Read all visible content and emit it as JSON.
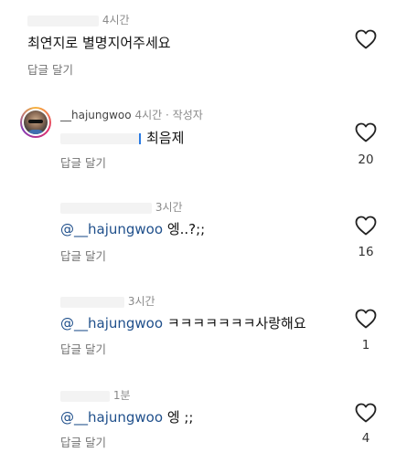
{
  "comments": [
    {
      "time": "4시간",
      "text": "최연지로 별명지어주세요",
      "reply_label": "답글 달기",
      "likes": ""
    },
    {
      "username": "__hajungwoo",
      "time": "4시간",
      "author_badge": "작성자",
      "text": "최음제",
      "reply_label": "답글 달기",
      "likes": "20"
    },
    {
      "time": "3시간",
      "mention": "@__hajungwoo",
      "text": "엥..?;;",
      "reply_label": "답글 달기",
      "likes": "16"
    },
    {
      "time": "3시간",
      "mention": "@__hajungwoo",
      "text": "ㅋㅋㅋㅋㅋㅋㅋ사랑해요",
      "reply_label": "답글 달기",
      "likes": "1"
    },
    {
      "time": "1분",
      "mention": "@__hajungwoo",
      "text": "엥 ;;",
      "reply_label": "답글 달기",
      "likes": "4"
    }
  ],
  "icons": {
    "like": "heart-outline-icon",
    "avatar": "profile-avatar"
  },
  "colors": {
    "mention": "#1f4f8b",
    "meta": "#8a8a8a",
    "reply": "#737373"
  }
}
